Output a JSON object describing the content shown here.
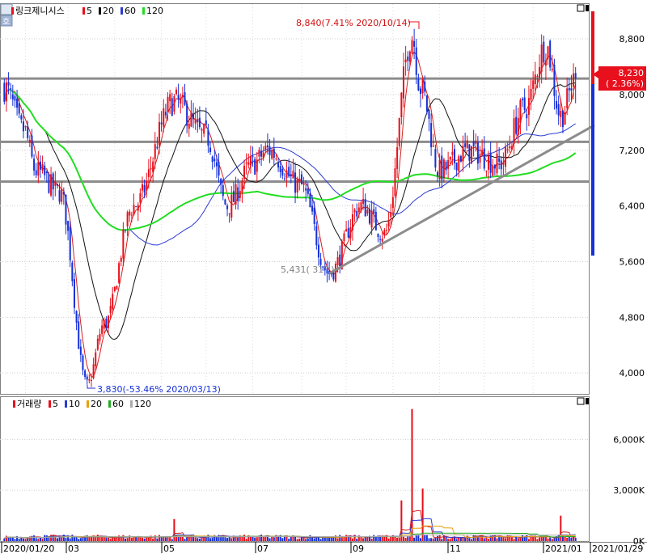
{
  "window": {
    "corner_button": "호",
    "price_panel_title": "링크제니시스",
    "volume_panel_title": "거래량"
  },
  "colors": {
    "up": "#e8101c",
    "down": "#1631d8",
    "ma5": "#d42020",
    "ma20": "#111111",
    "ma60": "#2b3bd0",
    "ma120": "#22dd22",
    "vol_ma10": "#2b3bd0",
    "vol_ma20": "#e8a010",
    "vol_ma60": "#22aa22",
    "vol_ma120": "#aaaaaa",
    "trendline": "#8c8c8c",
    "current_marker": "#e8101c"
  },
  "price_legend": [
    {
      "label": "5",
      "color": "#e8101c"
    },
    {
      "label": "20",
      "color": "#111111"
    },
    {
      "label": "60",
      "color": "#2b3bd0"
    },
    {
      "label": "120",
      "color": "#22dd22"
    }
  ],
  "volume_legend": [
    {
      "label": "5",
      "color": "#e8101c"
    },
    {
      "label": "10",
      "color": "#2b3bd0"
    },
    {
      "label": "20",
      "color": "#e8a010"
    },
    {
      "label": "60",
      "color": "#22aa22"
    },
    {
      "label": "120",
      "color": "#aaaaaa"
    }
  ],
  "chart_data": {
    "type": "candlestick",
    "x_axis_labels": [
      "2020/01/20",
      "03",
      "05",
      "07",
      "09",
      "11",
      "2021/01",
      "2021/01/29"
    ],
    "price_axis": {
      "ticks": [
        "8,800",
        "8,000",
        "7,200",
        "6,400",
        "5,600",
        "4,800",
        "4,000"
      ],
      "tick_values": [
        8800,
        8000,
        7200,
        6400,
        5600,
        4800,
        4000
      ],
      "range": [
        3700,
        9300
      ]
    },
    "volume_axis": {
      "ticks": [
        "6,000K",
        "3,000K",
        "0K"
      ],
      "tick_values": [
        6000,
        3000,
        0
      ],
      "range": [
        0,
        8500
      ]
    },
    "annotations": {
      "high": {
        "label": "8,840(7.41% 2020/10/14)",
        "value": 8840
      },
      "low": {
        "label": "3,830(-53.46% 2020/03/13)",
        "value": 3830
      },
      "angle": {
        "label": "5,431( 31° )",
        "value": 5431
      }
    },
    "current": {
      "price": "8,230",
      "change": "( 2.36%)",
      "value": 8230
    },
    "horizontal_lines": [
      8230,
      7320,
      6750
    ],
    "trendline": [
      {
        "date": "2020/08/20",
        "value": 5431
      },
      {
        "date": "2021/01/29",
        "value": 7560
      }
    ],
    "key_points": [
      {
        "date": "2020/01/20",
        "value": 8100
      },
      {
        "date": "2020/01/31",
        "value": 7500
      },
      {
        "date": "2020/02/10",
        "value": 6900
      },
      {
        "date": "2020/02/25",
        "value": 6600
      },
      {
        "date": "2020/03/13",
        "value": 3830
      },
      {
        "date": "2020/03/25",
        "value": 4700
      },
      {
        "date": "2020/04/14",
        "value": 6400
      },
      {
        "date": "2020/05/11",
        "value": 7900
      },
      {
        "date": "2020/06/01",
        "value": 7400
      },
      {
        "date": "2020/06/15",
        "value": 6400
      },
      {
        "date": "2020/07/01",
        "value": 7000
      },
      {
        "date": "2020/07/10",
        "value": 7200
      },
      {
        "date": "2020/08/01",
        "value": 6700
      },
      {
        "date": "2020/08/20",
        "value": 5431
      },
      {
        "date": "2020/09/10",
        "value": 6400
      },
      {
        "date": "2020/09/25",
        "value": 6000
      },
      {
        "date": "2020/10/14",
        "value": 8840
      },
      {
        "date": "2020/10/20",
        "value": 8100
      },
      {
        "date": "2020/11/01",
        "value": 6900
      },
      {
        "date": "2020/11/20",
        "value": 7200
      },
      {
        "date": "2020/12/10",
        "value": 7000
      },
      {
        "date": "2020/12/28",
        "value": 7800
      },
      {
        "date": "2021/01/10",
        "value": 8700
      },
      {
        "date": "2021/01/20",
        "value": 7700
      },
      {
        "date": "2021/01/29",
        "value": 8230
      }
    ],
    "volume_peaks": [
      {
        "date": "2020/10/14",
        "value": 7800
      },
      {
        "date": "2020/10/21",
        "value": 3100
      },
      {
        "date": "2020/10/07",
        "value": 2400
      },
      {
        "date": "2021/01/20",
        "value": 1500
      },
      {
        "date": "2020/05/11",
        "value": 1300
      }
    ]
  }
}
